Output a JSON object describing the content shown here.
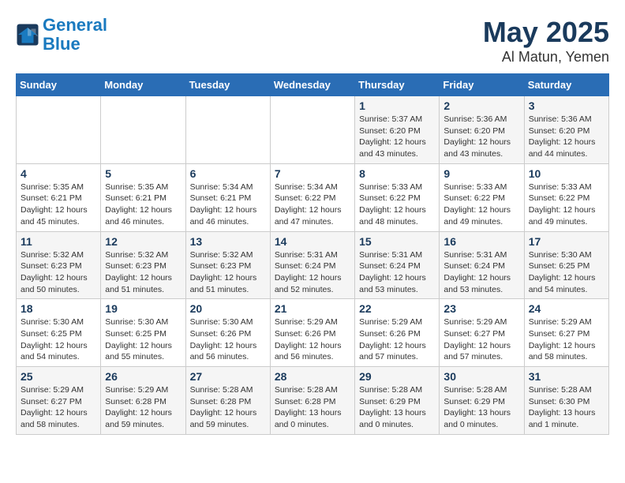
{
  "logo": {
    "line1": "General",
    "line2": "Blue"
  },
  "title": "May 2025",
  "subtitle": "Al Matun, Yemen",
  "weekdays": [
    "Sunday",
    "Monday",
    "Tuesday",
    "Wednesday",
    "Thursday",
    "Friday",
    "Saturday"
  ],
  "weeks": [
    [
      {
        "day": "",
        "info": ""
      },
      {
        "day": "",
        "info": ""
      },
      {
        "day": "",
        "info": ""
      },
      {
        "day": "",
        "info": ""
      },
      {
        "day": "1",
        "info": "Sunrise: 5:37 AM\nSunset: 6:20 PM\nDaylight: 12 hours\nand 43 minutes."
      },
      {
        "day": "2",
        "info": "Sunrise: 5:36 AM\nSunset: 6:20 PM\nDaylight: 12 hours\nand 43 minutes."
      },
      {
        "day": "3",
        "info": "Sunrise: 5:36 AM\nSunset: 6:20 PM\nDaylight: 12 hours\nand 44 minutes."
      }
    ],
    [
      {
        "day": "4",
        "info": "Sunrise: 5:35 AM\nSunset: 6:21 PM\nDaylight: 12 hours\nand 45 minutes."
      },
      {
        "day": "5",
        "info": "Sunrise: 5:35 AM\nSunset: 6:21 PM\nDaylight: 12 hours\nand 46 minutes."
      },
      {
        "day": "6",
        "info": "Sunrise: 5:34 AM\nSunset: 6:21 PM\nDaylight: 12 hours\nand 46 minutes."
      },
      {
        "day": "7",
        "info": "Sunrise: 5:34 AM\nSunset: 6:22 PM\nDaylight: 12 hours\nand 47 minutes."
      },
      {
        "day": "8",
        "info": "Sunrise: 5:33 AM\nSunset: 6:22 PM\nDaylight: 12 hours\nand 48 minutes."
      },
      {
        "day": "9",
        "info": "Sunrise: 5:33 AM\nSunset: 6:22 PM\nDaylight: 12 hours\nand 49 minutes."
      },
      {
        "day": "10",
        "info": "Sunrise: 5:33 AM\nSunset: 6:22 PM\nDaylight: 12 hours\nand 49 minutes."
      }
    ],
    [
      {
        "day": "11",
        "info": "Sunrise: 5:32 AM\nSunset: 6:23 PM\nDaylight: 12 hours\nand 50 minutes."
      },
      {
        "day": "12",
        "info": "Sunrise: 5:32 AM\nSunset: 6:23 PM\nDaylight: 12 hours\nand 51 minutes."
      },
      {
        "day": "13",
        "info": "Sunrise: 5:32 AM\nSunset: 6:23 PM\nDaylight: 12 hours\nand 51 minutes."
      },
      {
        "day": "14",
        "info": "Sunrise: 5:31 AM\nSunset: 6:24 PM\nDaylight: 12 hours\nand 52 minutes."
      },
      {
        "day": "15",
        "info": "Sunrise: 5:31 AM\nSunset: 6:24 PM\nDaylight: 12 hours\nand 53 minutes."
      },
      {
        "day": "16",
        "info": "Sunrise: 5:31 AM\nSunset: 6:24 PM\nDaylight: 12 hours\nand 53 minutes."
      },
      {
        "day": "17",
        "info": "Sunrise: 5:30 AM\nSunset: 6:25 PM\nDaylight: 12 hours\nand 54 minutes."
      }
    ],
    [
      {
        "day": "18",
        "info": "Sunrise: 5:30 AM\nSunset: 6:25 PM\nDaylight: 12 hours\nand 54 minutes."
      },
      {
        "day": "19",
        "info": "Sunrise: 5:30 AM\nSunset: 6:25 PM\nDaylight: 12 hours\nand 55 minutes."
      },
      {
        "day": "20",
        "info": "Sunrise: 5:30 AM\nSunset: 6:26 PM\nDaylight: 12 hours\nand 56 minutes."
      },
      {
        "day": "21",
        "info": "Sunrise: 5:29 AM\nSunset: 6:26 PM\nDaylight: 12 hours\nand 56 minutes."
      },
      {
        "day": "22",
        "info": "Sunrise: 5:29 AM\nSunset: 6:26 PM\nDaylight: 12 hours\nand 57 minutes."
      },
      {
        "day": "23",
        "info": "Sunrise: 5:29 AM\nSunset: 6:27 PM\nDaylight: 12 hours\nand 57 minutes."
      },
      {
        "day": "24",
        "info": "Sunrise: 5:29 AM\nSunset: 6:27 PM\nDaylight: 12 hours\nand 58 minutes."
      }
    ],
    [
      {
        "day": "25",
        "info": "Sunrise: 5:29 AM\nSunset: 6:27 PM\nDaylight: 12 hours\nand 58 minutes."
      },
      {
        "day": "26",
        "info": "Sunrise: 5:29 AM\nSunset: 6:28 PM\nDaylight: 12 hours\nand 59 minutes."
      },
      {
        "day": "27",
        "info": "Sunrise: 5:28 AM\nSunset: 6:28 PM\nDaylight: 12 hours\nand 59 minutes."
      },
      {
        "day": "28",
        "info": "Sunrise: 5:28 AM\nSunset: 6:28 PM\nDaylight: 13 hours\nand 0 minutes."
      },
      {
        "day": "29",
        "info": "Sunrise: 5:28 AM\nSunset: 6:29 PM\nDaylight: 13 hours\nand 0 minutes."
      },
      {
        "day": "30",
        "info": "Sunrise: 5:28 AM\nSunset: 6:29 PM\nDaylight: 13 hours\nand 0 minutes."
      },
      {
        "day": "31",
        "info": "Sunrise: 5:28 AM\nSunset: 6:30 PM\nDaylight: 13 hours\nand 1 minute."
      }
    ]
  ]
}
